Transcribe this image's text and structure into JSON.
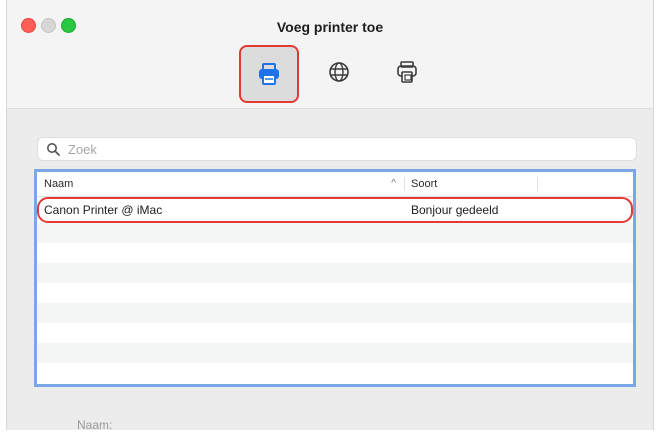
{
  "window": {
    "title": "Voeg printer toe"
  },
  "toolbar": {
    "buttons": [
      {
        "icon": "printer-default-icon",
        "selected": true
      },
      {
        "icon": "globe-ip-icon",
        "selected": false
      },
      {
        "icon": "windows-printer-icon",
        "selected": false
      }
    ]
  },
  "search": {
    "placeholder": "Zoek",
    "value": ""
  },
  "table": {
    "columns": [
      "Naam",
      "Soort"
    ],
    "sort_column": "Naam",
    "rows": [
      {
        "name": "Canon Printer @ iMac",
        "kind": "Bonjour gedeeld",
        "selected": true
      }
    ]
  },
  "footer": {
    "name_label": "Naam:"
  },
  "colors": {
    "highlight": "#e53935",
    "table_focus": "#7aa8e6"
  }
}
